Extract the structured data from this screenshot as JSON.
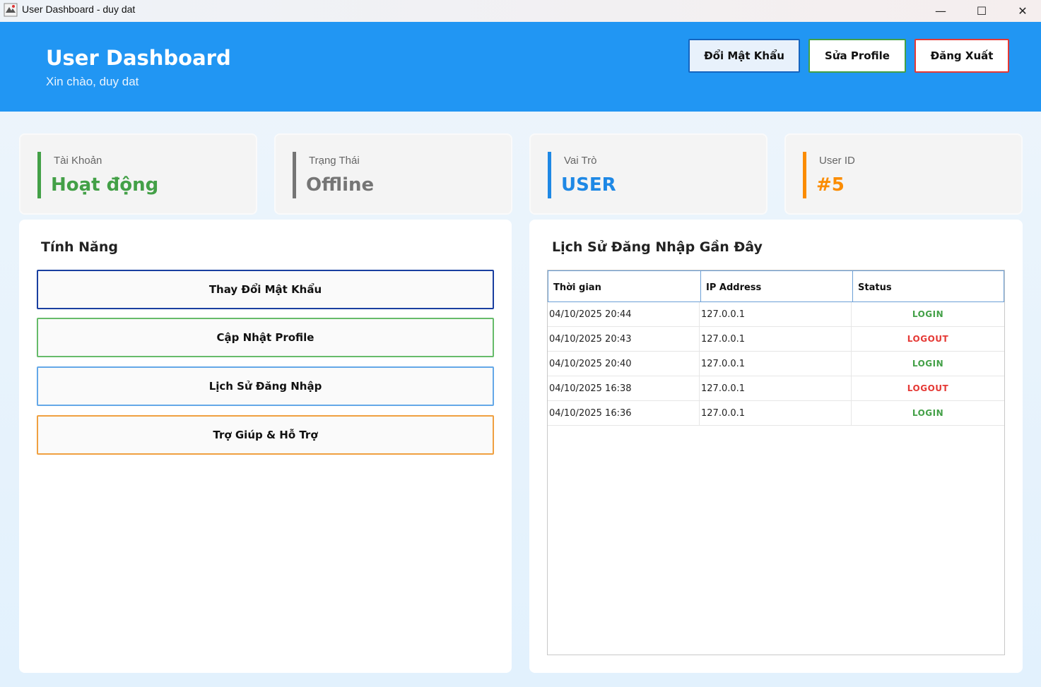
{
  "window": {
    "title": "User Dashboard - duy dat",
    "minimize": "—",
    "maximize": "☐",
    "close": "✕"
  },
  "header": {
    "title": "User Dashboard",
    "subtitle": "Xin chào, duy dat",
    "buttons": {
      "change_password": "Đổi Mật Khẩu",
      "edit_profile": "Sửa Profile",
      "logout": "Đăng Xuất"
    }
  },
  "stats": [
    {
      "label": "Tài Khoản",
      "value": "Hoạt động",
      "color": "#43a047"
    },
    {
      "label": "Trạng Thái",
      "value": "Offline",
      "color": "#757575"
    },
    {
      "label": "Vai Trò",
      "value": "USER",
      "color": "#1e88e5"
    },
    {
      "label": "User ID",
      "value": "#5",
      "color": "#fb8c00"
    }
  ],
  "features": {
    "title": "Tính Năng",
    "items": [
      {
        "label": "Thay Đổi Mật Khẩu",
        "border": "#1a3fa0"
      },
      {
        "label": "Cập Nhật Profile",
        "border": "#66bb6a"
      },
      {
        "label": "Lịch Sử Đăng Nhập",
        "border": "#64a8e8"
      },
      {
        "label": "Trợ Giúp & Hỗ Trợ",
        "border": "#f0a040"
      }
    ]
  },
  "history": {
    "title": "Lịch Sử Đăng Nhập Gần Đây",
    "columns": [
      "Thời gian",
      "IP Address",
      "Status"
    ],
    "rows": [
      {
        "time": "04/10/2025 20:44",
        "ip": "127.0.0.1",
        "status": "LOGIN"
      },
      {
        "time": "04/10/2025 20:43",
        "ip": "127.0.0.1",
        "status": "LOGOUT"
      },
      {
        "time": "04/10/2025 20:40",
        "ip": "127.0.0.1",
        "status": "LOGIN"
      },
      {
        "time": "04/10/2025 16:38",
        "ip": "127.0.0.1",
        "status": "LOGOUT"
      },
      {
        "time": "04/10/2025 16:36",
        "ip": "127.0.0.1",
        "status": "LOGIN"
      }
    ],
    "status_colors": {
      "LOGIN": "#43a047",
      "LOGOUT": "#e53935"
    }
  }
}
